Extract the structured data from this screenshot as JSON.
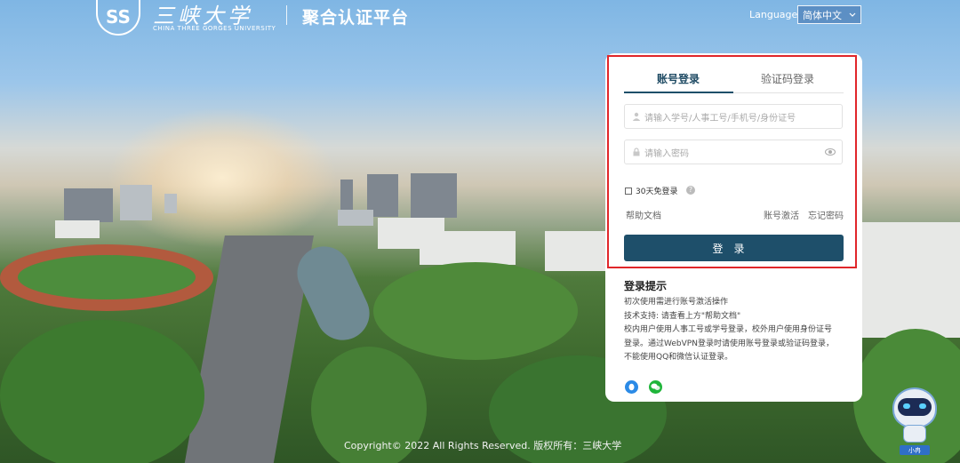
{
  "header": {
    "logo_text": "SS",
    "school_name": "三峡大学",
    "school_name_en": "CHINA THREE GORGES UNIVERSITY",
    "platform_title": "聚合认证平台",
    "language_label": "Language",
    "language_selected": "简体中文"
  },
  "login": {
    "tabs": [
      {
        "label": "账号登录",
        "active": true
      },
      {
        "label": "验证码登录",
        "active": false
      }
    ],
    "username_placeholder": "请输入学号/人事工号/手机号/身份证号",
    "password_placeholder": "请输入密码",
    "remember_label": "30天免登录",
    "help_doc_link": "帮助文档",
    "activate_link": "账号激活",
    "forgot_link": "忘记密码",
    "submit_label": "登录"
  },
  "tips": {
    "title": "登录提示",
    "lines": [
      "初次使用需进行账号激活操作",
      "技术支持: 请查看上方\"帮助文档\"",
      "校内用户使用人事工号或学号登录，校外用户使用身份证号",
      "登录。通过WebVPN登录时请使用账号登录或验证码登录，",
      "不能使用QQ和微信认证登录。"
    ]
  },
  "social": [
    {
      "icon": "qq-icon",
      "color": "#2b8ae6"
    },
    {
      "icon": "wechat-icon",
      "color": "#1fb53a"
    }
  ],
  "footer": {
    "copyright": "Copyright© 2022 All Rights Reserved. 版权所有：三峡大学"
  },
  "assistant": {
    "label": "小冉"
  },
  "colors": {
    "primary": "#1e4f6a",
    "highlight_border": "#e0262a"
  }
}
